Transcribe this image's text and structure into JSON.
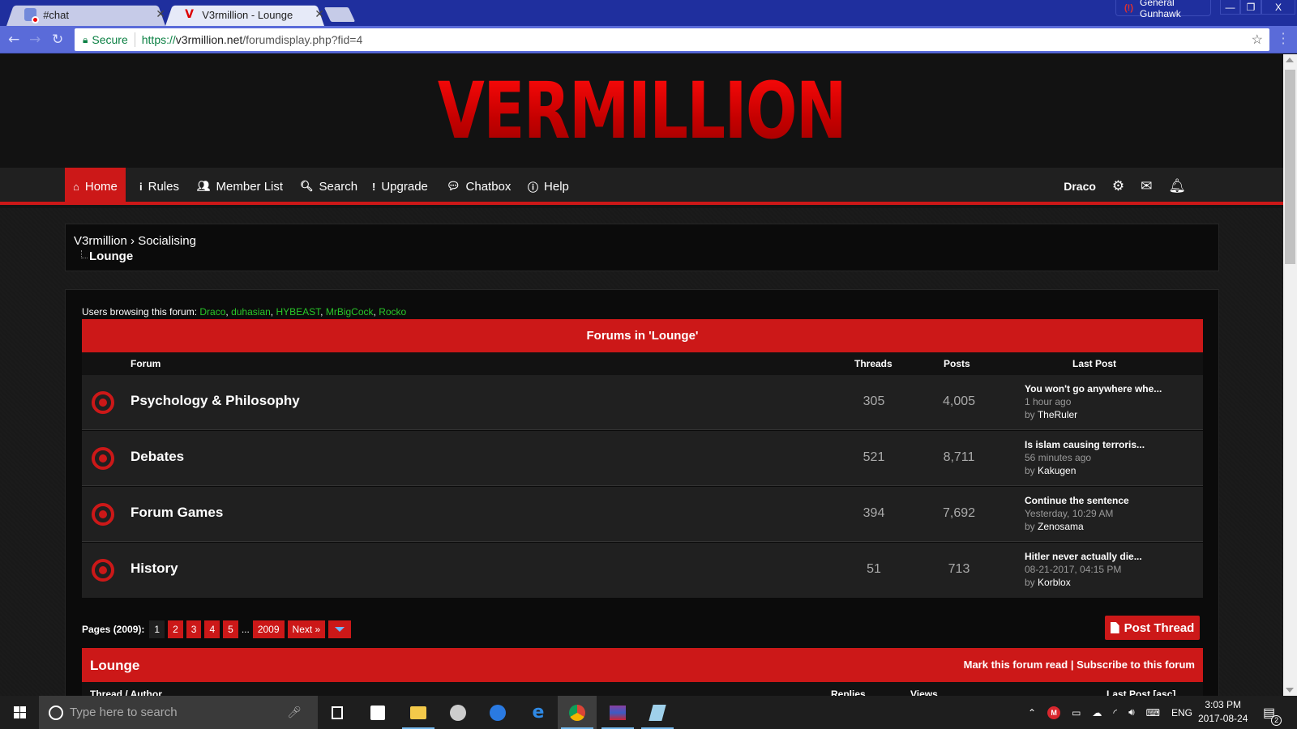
{
  "browser": {
    "tabs": [
      {
        "label": "#chat",
        "icon": "discord-icon",
        "active": false
      },
      {
        "label": "V3rmillion - Lounge",
        "icon": "v3rmillion-icon",
        "active": true
      }
    ],
    "profile_name": "General Gunhawk",
    "secure_label": "Secure",
    "url_scheme": "https://",
    "url_host": "v3rmillion.net",
    "url_path": "/forumdisplay.php?fid=4"
  },
  "site": {
    "logo_text": "VERMILLION",
    "accent_color": "#cc1818",
    "nav": [
      {
        "label": "Home",
        "icon": "home-icon",
        "active": true
      },
      {
        "label": "Rules",
        "icon": "info-icon"
      },
      {
        "label": "Member List",
        "icon": "users-icon"
      },
      {
        "label": "Search",
        "icon": "search-icon"
      },
      {
        "label": "Upgrade",
        "icon": "exclamation-icon"
      },
      {
        "label": "Chatbox",
        "icon": "chat-bubble-icon"
      },
      {
        "label": "Help",
        "icon": "info-circle-icon"
      }
    ],
    "username": "Draco"
  },
  "breadcrumb": {
    "root": "V3rmillion",
    "sep": "›",
    "parent": "Socialising",
    "current": "Lounge"
  },
  "browsing": {
    "label": "Users browsing this forum:",
    "users": [
      "Draco",
      "duhasian",
      "HYBEAST",
      "MrBigCock",
      "Rocko"
    ]
  },
  "subforums": {
    "title": "Forums in 'Lounge'",
    "columns": {
      "forum": "Forum",
      "threads": "Threads",
      "posts": "Posts",
      "last_post": "Last Post"
    },
    "rows": [
      {
        "name": "Psychology & Philosophy",
        "threads": "305",
        "posts": "4,005",
        "last_title": "You won't go anywhere whe...",
        "last_time": "1 hour ago",
        "by": "by",
        "last_author": "TheRuler"
      },
      {
        "name": "Debates",
        "threads": "521",
        "posts": "8,711",
        "last_title": "Is islam causing terroris...",
        "last_time": "56 minutes ago",
        "by": "by",
        "last_author": "Kakugen"
      },
      {
        "name": "Forum Games",
        "threads": "394",
        "posts": "7,692",
        "last_title": "Continue the sentence",
        "last_time": "Yesterday, 10:29 AM",
        "by": "by",
        "last_author": "Zenosama"
      },
      {
        "name": "History",
        "threads": "51",
        "posts": "713",
        "last_title": "Hitler never actually die...",
        "last_time": "08-21-2017, 04:15 PM",
        "by": "by",
        "last_author": "Korblox"
      }
    ]
  },
  "pagination": {
    "label": "Pages (2009):",
    "pages": [
      "1",
      "2",
      "3",
      "4",
      "5"
    ],
    "current": "1",
    "ellipsis": "...",
    "last": "2009",
    "next": "Next »"
  },
  "post_thread_label": "Post Thread",
  "thread_list": {
    "title": "Lounge",
    "actions": "Mark this forum read | Subscribe to this forum",
    "mark_read": "Mark this forum read",
    "subscribe": "Subscribe to this forum",
    "columns": {
      "thread": "Thread / Author",
      "replies": "Replies",
      "views": "Views",
      "last_post": "Last Post [asc]"
    }
  },
  "taskbar": {
    "search_placeholder": "Type here to search",
    "language": "ENG",
    "time": "3:03 PM",
    "date": "2017-08-24",
    "notification_count": "2"
  }
}
